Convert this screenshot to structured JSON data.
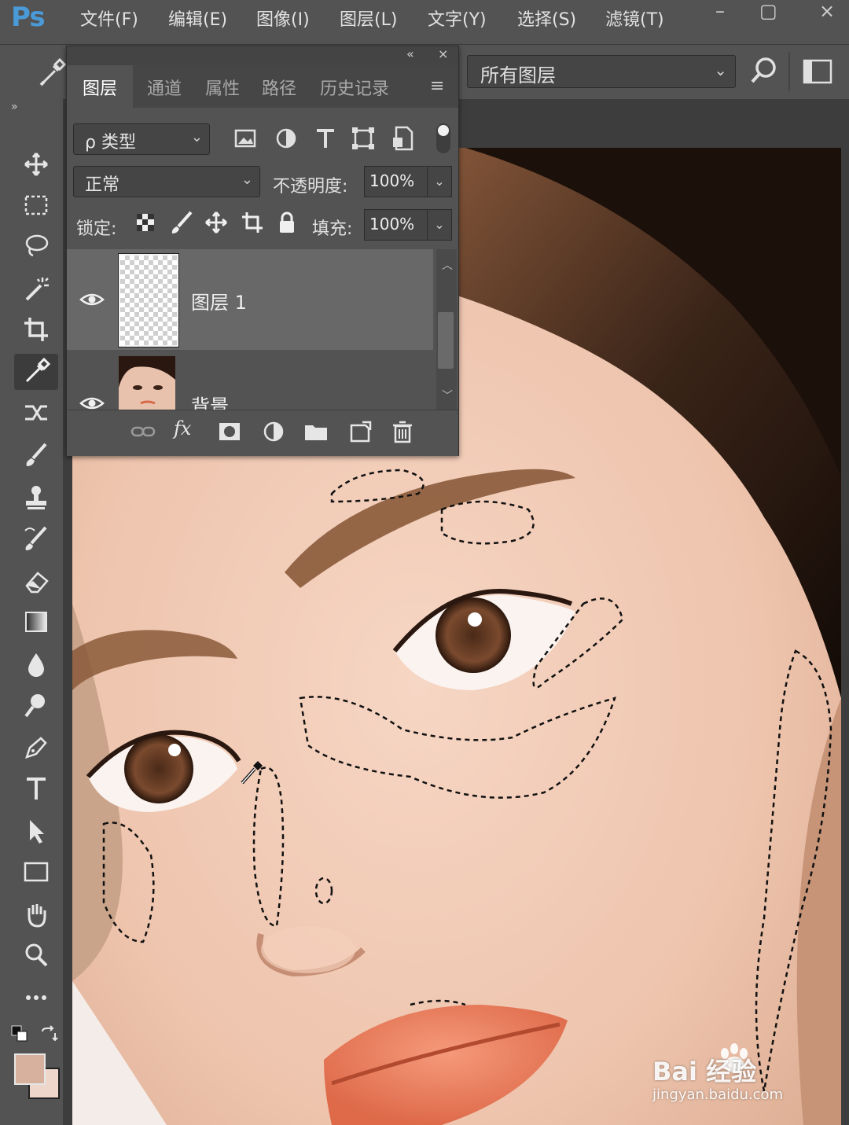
{
  "app": {
    "logo": "Ps",
    "menu": [
      "文件(F)",
      "编辑(E)",
      "图像(I)",
      "图层(L)",
      "文字(Y)",
      "选择(S)",
      "滤镜(T)"
    ],
    "window_controls": [
      "–",
      "▢",
      "×"
    ]
  },
  "options_bar": {
    "sample_label": "所有图层",
    "icons": [
      "eyedropper-icon",
      "search-icon",
      "workspace-icon"
    ]
  },
  "toolbar": {
    "collapse": "»",
    "tools": [
      "move",
      "marquee",
      "lasso",
      "magic-wand",
      "crop",
      "eyedropper",
      "patch",
      "brush",
      "stamp",
      "history-brush",
      "eraser",
      "gradient",
      "blur",
      "dodge",
      "pen",
      "type",
      "path-select",
      "rectangle",
      "hand",
      "zoom",
      "more"
    ],
    "active_tool": "eyedropper",
    "foreground_color": "#d7b09e",
    "background_color": "#efd6ca"
  },
  "panel": {
    "header_controls": [
      "«",
      "×"
    ],
    "tabs": [
      "图层",
      "通道",
      "属性",
      "路径",
      "历史记录"
    ],
    "active_tab": "图层",
    "menu_icon": "≡",
    "filter_kind": "ρ 类型",
    "blend_mode": "正常",
    "opacity_label": "不透明度:",
    "opacity_value": "100%",
    "lock_label": "锁定:",
    "fill_label": "填充:",
    "fill_value": "100%",
    "layers": [
      {
        "name": "图层 1",
        "visible": true,
        "selected": true
      },
      {
        "name": "背景",
        "visible": true,
        "selected": false
      }
    ],
    "footer_icons": [
      "link-icon",
      "fx-icon",
      "mask-icon",
      "adjustment-icon",
      "folder-icon",
      "new-layer-icon",
      "trash-icon"
    ],
    "footer_fx": "fx"
  },
  "watermark": {
    "brand": "Bai 经验",
    "url": "jingyan.baidu.com"
  }
}
